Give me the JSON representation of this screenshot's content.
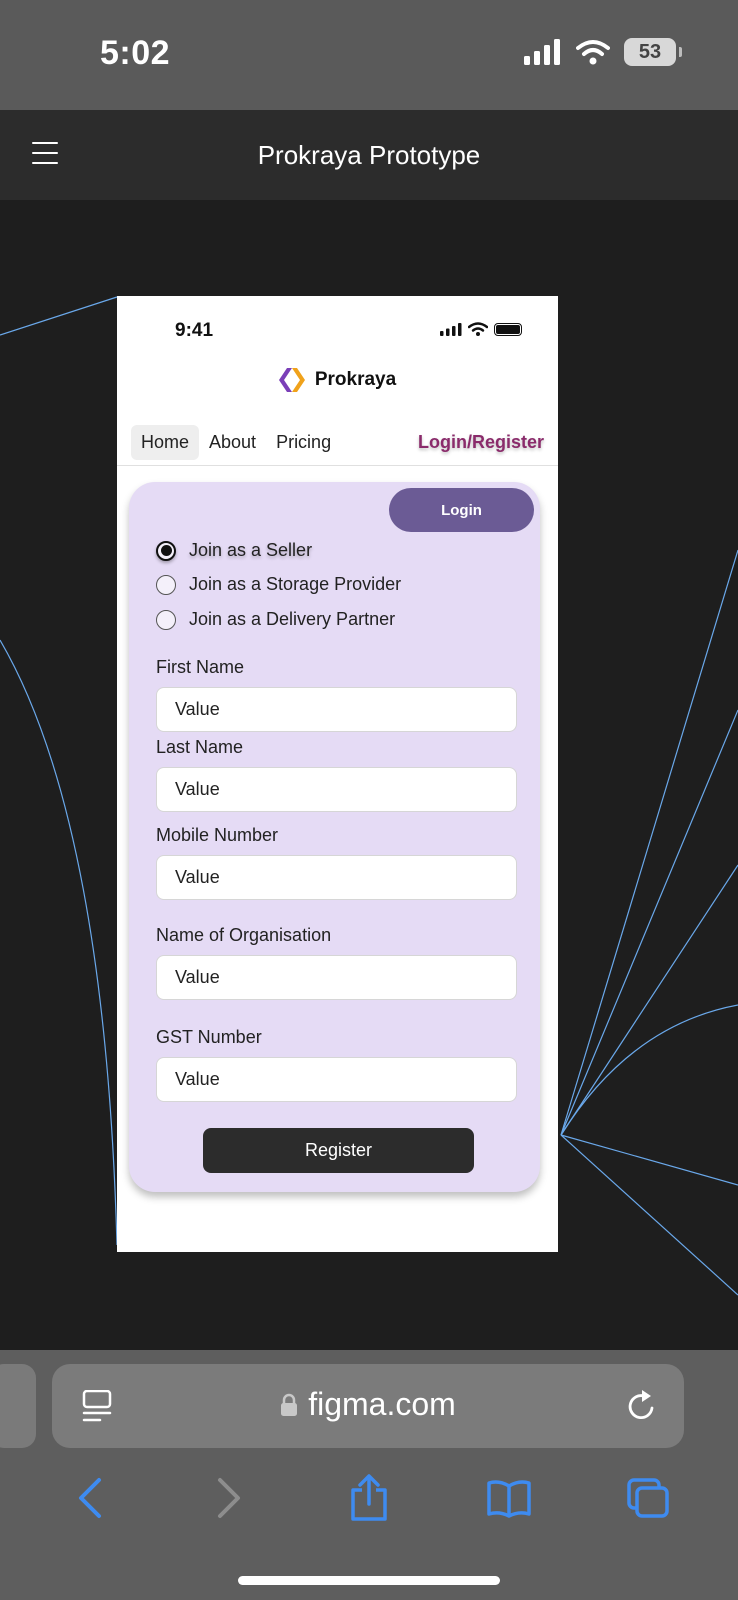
{
  "os_status": {
    "time": "5:02",
    "battery": "53"
  },
  "app_header": {
    "title": "Prokraya Prototype"
  },
  "prototype": {
    "status_time": "9:41",
    "brand": "Prokraya",
    "nav": {
      "home": "Home",
      "about": "About",
      "pricing": "Pricing",
      "login_register": "Login/Register"
    },
    "login_button": "Login",
    "join_options": [
      {
        "label": "Join as a Seller",
        "selected": true
      },
      {
        "label": "Join as a Storage Provider",
        "selected": false
      },
      {
        "label": "Join as a Delivery Partner",
        "selected": false
      }
    ],
    "fields": [
      {
        "label": "First Name",
        "value": "Value"
      },
      {
        "label": "Last Name",
        "value": "Value"
      },
      {
        "label": "Mobile Number",
        "value": "Value"
      },
      {
        "label": "Name of Organisation",
        "value": "Value"
      },
      {
        "label": "GST Number",
        "value": "Value"
      }
    ],
    "register_button": "Register",
    "colors": {
      "card": "#e5dbf5",
      "login_button": "#6b5b95",
      "login_link": "#8a2b6b",
      "register_button": "#2c2c2c"
    }
  },
  "browser": {
    "url": "figma.com"
  }
}
